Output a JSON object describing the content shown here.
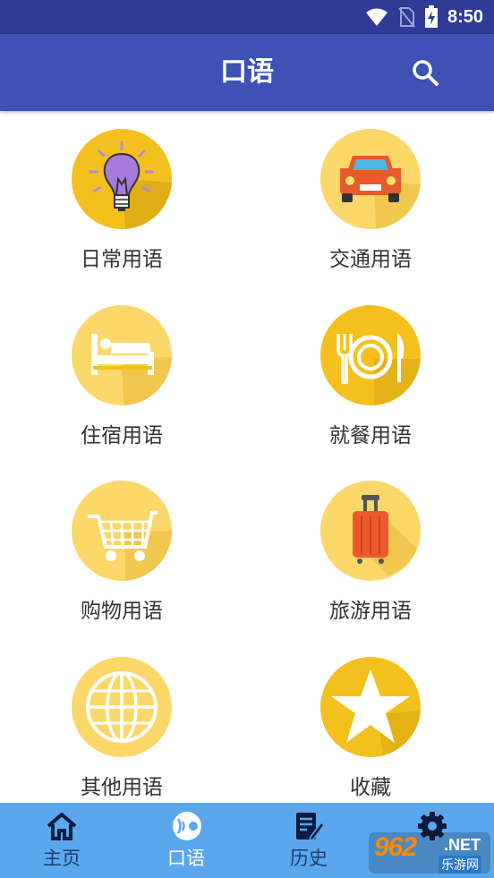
{
  "status_bar": {
    "time": "8:50"
  },
  "app_bar": {
    "title": "口语"
  },
  "categories": [
    {
      "label": "日常用语",
      "icon": "lightbulb-icon"
    },
    {
      "label": "交通用语",
      "icon": "car-icon"
    },
    {
      "label": "住宿用语",
      "icon": "bed-icon"
    },
    {
      "label": "就餐用语",
      "icon": "dining-icon"
    },
    {
      "label": "购物用语",
      "icon": "shopping-cart-icon"
    },
    {
      "label": "旅游用语",
      "icon": "suitcase-icon"
    },
    {
      "label": "其他用语",
      "icon": "globe-icon"
    },
    {
      "label": "收藏",
      "icon": "star-icon"
    }
  ],
  "bottom_nav": [
    {
      "label": "主页",
      "icon": "home-icon",
      "active": false
    },
    {
      "label": "口语",
      "icon": "speech-icon",
      "active": true
    },
    {
      "label": "历史",
      "icon": "history-icon",
      "active": false
    },
    {
      "label": "",
      "icon": "gear-icon",
      "active": false
    }
  ],
  "watermark": {
    "number": "962",
    "suffix": ".NET",
    "sub": "乐游网"
  },
  "colors": {
    "status_bar": "#2f3b95",
    "app_bar": "#3f51b5",
    "bottom_nav": "#5aa7ee",
    "circle_yellow": "#fcd86a",
    "circle_gold": "#f4c01e"
  }
}
